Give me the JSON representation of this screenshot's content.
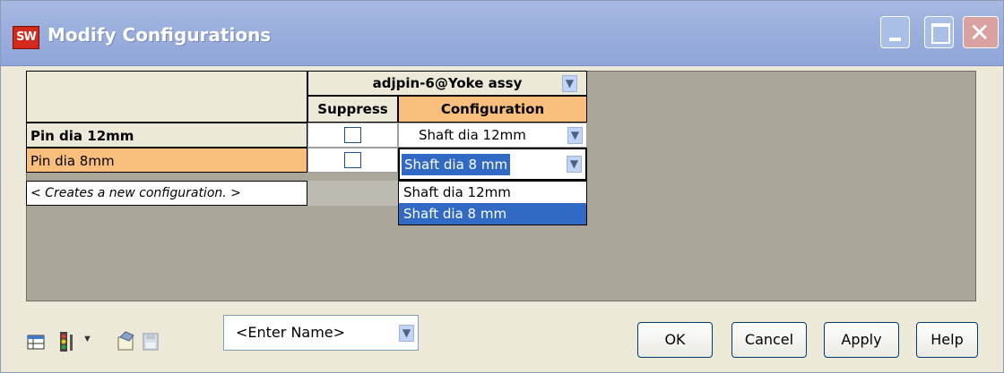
{
  "window": {
    "title": "Modify Configurations",
    "app_icon_text": "SW"
  },
  "table": {
    "component_header": "adjpin-6@Yoke assy",
    "columns": {
      "suppress": "Suppress",
      "configuration": "Configuration"
    },
    "rows": [
      {
        "name": "Pin dia 12mm",
        "suppress": false,
        "configuration": "Shaft dia 12mm"
      },
      {
        "name": "Pin dia 8mm",
        "suppress": false,
        "configuration": "Shaft dia 8 mm"
      },
      {
        "name": "< Creates a new configuration. >"
      }
    ],
    "dropdown_options": [
      "Shaft dia 12mm",
      "Shaft dia 8 mm"
    ],
    "dropdown_selected": "Shaft dia 8 mm"
  },
  "bottom": {
    "name_field_value": "<Enter Name>",
    "buttons": {
      "ok": "OK",
      "cancel": "Cancel",
      "apply": "Apply",
      "help": "Help"
    }
  },
  "colors": {
    "selected_row": "#f9be7c",
    "selected_item": "#316ac5",
    "grid_background": "#aaa699",
    "title_bar": "#9cb0dd"
  }
}
